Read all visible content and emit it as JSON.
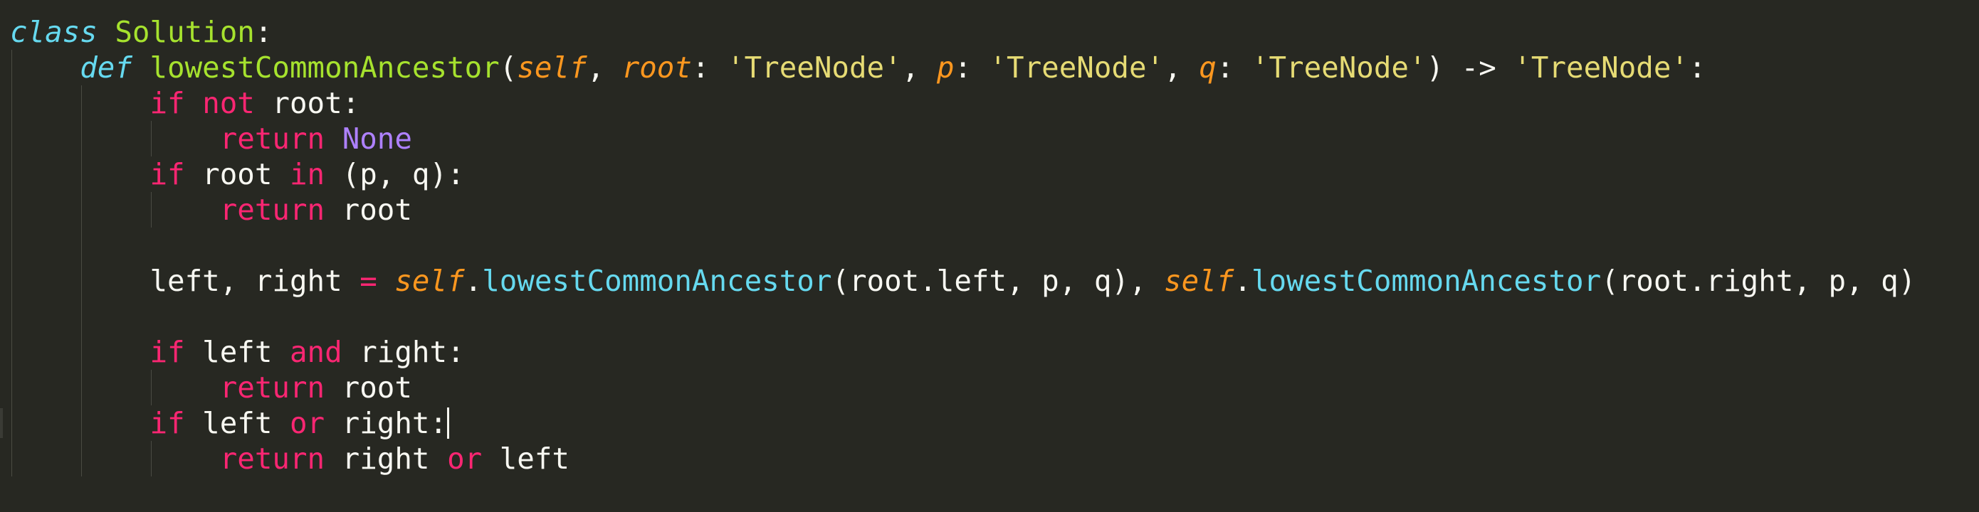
{
  "colors": {
    "background": "#272822",
    "keyword_pink": "#f92672",
    "storage_cyan": "#66d9ef",
    "class_green": "#a6e22e",
    "param_orange": "#fd971f",
    "string_yellow": "#e6db74",
    "constant_purple": "#ae81ff",
    "plain_text": "#f8f8f2",
    "indent_guide": "#4a4b43"
  },
  "editor": {
    "language": "python",
    "cursor_line": 11,
    "lines": [
      {
        "indent": 0,
        "tokens": [
          {
            "t": "class",
            "c": "#66d9ef",
            "i": true
          },
          {
            "t": " "
          },
          {
            "t": "Solution",
            "c": "#a6e22e"
          },
          {
            "t": ":"
          }
        ]
      },
      {
        "indent": 4,
        "tokens": [
          {
            "t": "def",
            "c": "#66d9ef",
            "i": true
          },
          {
            "t": " "
          },
          {
            "t": "lowestCommonAncestor",
            "c": "#a6e22e"
          },
          {
            "t": "("
          },
          {
            "t": "self",
            "c": "#fd971f",
            "i": true
          },
          {
            "t": ", "
          },
          {
            "t": "root",
            "c": "#fd971f",
            "i": true
          },
          {
            "t": ": "
          },
          {
            "t": "'TreeNode'",
            "c": "#e6db74"
          },
          {
            "t": ", "
          },
          {
            "t": "p",
            "c": "#fd971f",
            "i": true
          },
          {
            "t": ": "
          },
          {
            "t": "'TreeNode'",
            "c": "#e6db74"
          },
          {
            "t": ", "
          },
          {
            "t": "q",
            "c": "#fd971f",
            "i": true
          },
          {
            "t": ": "
          },
          {
            "t": "'TreeNode'",
            "c": "#e6db74"
          },
          {
            "t": ") -> "
          },
          {
            "t": "'TreeNode'",
            "c": "#e6db74"
          },
          {
            "t": ":"
          }
        ]
      },
      {
        "indent": 8,
        "tokens": [
          {
            "t": "if",
            "c": "#f92672"
          },
          {
            "t": " "
          },
          {
            "t": "not",
            "c": "#f92672"
          },
          {
            "t": " root:"
          }
        ]
      },
      {
        "indent": 12,
        "tokens": [
          {
            "t": "return",
            "c": "#f92672"
          },
          {
            "t": " "
          },
          {
            "t": "None",
            "c": "#ae81ff"
          }
        ]
      },
      {
        "indent": 8,
        "tokens": [
          {
            "t": "if",
            "c": "#f92672"
          },
          {
            "t": " root "
          },
          {
            "t": "in",
            "c": "#f92672"
          },
          {
            "t": " (p, q):"
          }
        ]
      },
      {
        "indent": 12,
        "tokens": [
          {
            "t": "return",
            "c": "#f92672"
          },
          {
            "t": " root"
          }
        ]
      },
      {
        "indent": 0,
        "tokens": []
      },
      {
        "indent": 8,
        "tokens": [
          {
            "t": "left, right "
          },
          {
            "t": "=",
            "c": "#f92672"
          },
          {
            "t": " "
          },
          {
            "t": "self",
            "c": "#fd971f",
            "i": true
          },
          {
            "t": "."
          },
          {
            "t": "lowestCommonAncestor",
            "c": "#66d9ef"
          },
          {
            "t": "(root.left, p, q), "
          },
          {
            "t": "self",
            "c": "#fd971f",
            "i": true
          },
          {
            "t": "."
          },
          {
            "t": "lowestCommonAncestor",
            "c": "#66d9ef"
          },
          {
            "t": "(root.right, p, q)"
          }
        ]
      },
      {
        "indent": 0,
        "tokens": []
      },
      {
        "indent": 8,
        "tokens": [
          {
            "t": "if",
            "c": "#f92672"
          },
          {
            "t": " left "
          },
          {
            "t": "and",
            "c": "#f92672"
          },
          {
            "t": " right:"
          }
        ]
      },
      {
        "indent": 12,
        "tokens": [
          {
            "t": "return",
            "c": "#f92672"
          },
          {
            "t": " root"
          }
        ]
      },
      {
        "indent": 8,
        "tokens": [
          {
            "t": "if",
            "c": "#f92672"
          },
          {
            "t": " left "
          },
          {
            "t": "or",
            "c": "#f92672"
          },
          {
            "t": " right:"
          }
        ]
      },
      {
        "indent": 12,
        "tokens": [
          {
            "t": "return",
            "c": "#f92672"
          },
          {
            "t": " right "
          },
          {
            "t": "or",
            "c": "#f92672"
          },
          {
            "t": " left"
          }
        ]
      }
    ]
  }
}
